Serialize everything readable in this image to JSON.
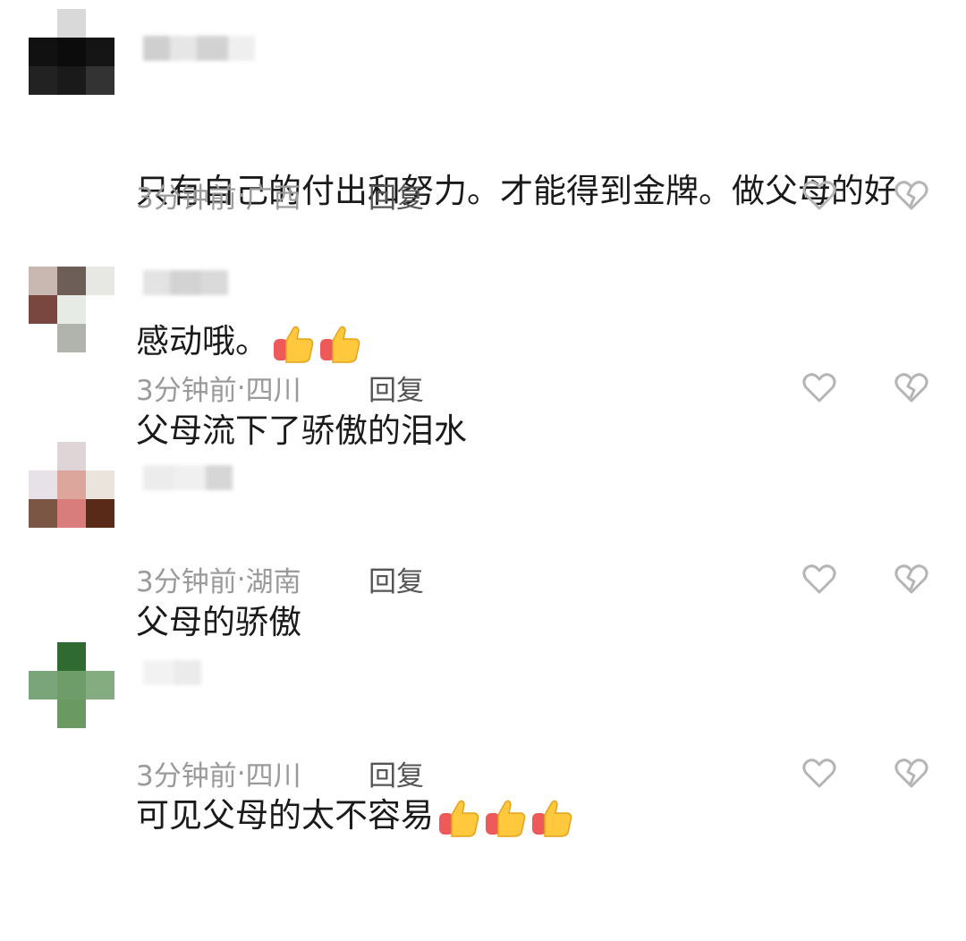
{
  "comments": [
    {
      "text_line1": "只有自己的付出和努力。才能得到金牌。做父母的好",
      "text_line2": "感动哦。",
      "thumbs": 2,
      "time": "3分钟前",
      "location": "广西",
      "reply_label": "回复"
    },
    {
      "text_line1": "父母流下了骄傲的泪水",
      "thumbs": 0,
      "time": "3分钟前",
      "location": "四川",
      "reply_label": "回复"
    },
    {
      "text_line1": "父母的骄傲",
      "thumbs": 0,
      "time": "3分钟前",
      "location": "湖南",
      "reply_label": "回复"
    },
    {
      "text_line1": "可见父母的太不容易",
      "thumbs": 3,
      "time": "3分钟前",
      "location": "四川",
      "reply_label": "回复"
    }
  ],
  "separator": " · ",
  "icons": {
    "like": "heart-outline-icon",
    "dislike": "broken-heart-icon",
    "emoji": "thumbs-up-emoji-icon"
  },
  "colors": {
    "text": "#1a1a1a",
    "meta": "#9a9a9a",
    "reply": "#555555",
    "icon": "#b5b5b5"
  }
}
